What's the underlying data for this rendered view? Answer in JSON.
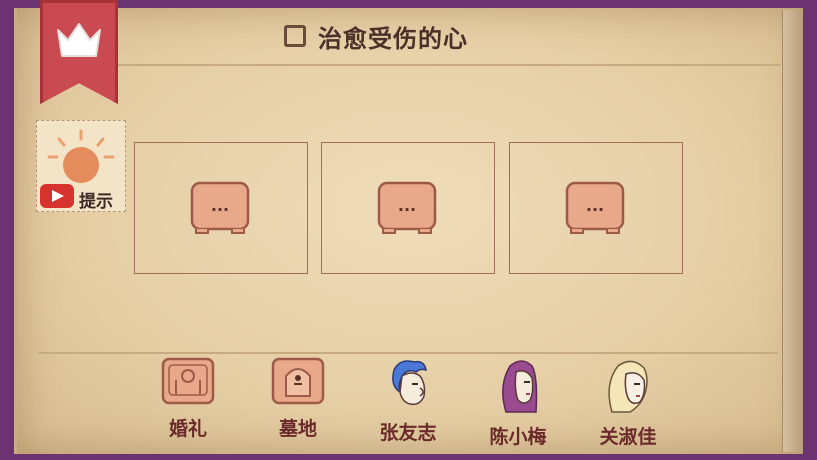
{
  "title": "治愈受伤的心",
  "hint": {
    "label": "提示"
  },
  "slots": [
    {
      "placeholder": "..."
    },
    {
      "placeholder": "..."
    },
    {
      "placeholder": "..."
    }
  ],
  "characters": [
    {
      "label": "婚礼",
      "icon": "wedding-card-icon"
    },
    {
      "label": "墓地",
      "icon": "tombstone-card-icon"
    },
    {
      "label": "张友志",
      "icon": "blue-haired-man-portrait"
    },
    {
      "label": "陈小梅",
      "icon": "purple-haired-woman-portrait"
    },
    {
      "label": "关淑佳",
      "icon": "blonde-woman-portrait"
    }
  ],
  "colors": {
    "frame": "#6b3370",
    "paper": "#e6cfa6",
    "bookmark": "#c94a50",
    "card": "#e8a98a",
    "label": "#6a2a2a"
  }
}
